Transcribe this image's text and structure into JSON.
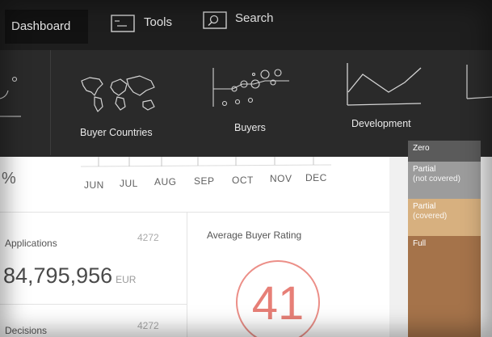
{
  "nav": {
    "dashboard": "Dashboard",
    "tools": "Tools",
    "search": "Search"
  },
  "tools": {
    "buyer_countries": "Buyer Countries",
    "buyers": "Buyers",
    "development": "Development"
  },
  "timeline": {
    "left_fragment": "%",
    "months": [
      "JUN",
      "JUL",
      "AUG",
      "SEP",
      "OCT",
      "NOV",
      "DEC"
    ]
  },
  "applications": {
    "title": "Applications",
    "count": "4272",
    "amount": "84,795,956",
    "unit": "EUR"
  },
  "decisions": {
    "title": "Decisions",
    "count": "4272"
  },
  "rating": {
    "title": "Average Buyer Rating",
    "value": "41"
  },
  "legend": [
    {
      "label": "Zero",
      "color": "#5b5b5b"
    },
    {
      "label": "Partial\n(not covered)",
      "color": "#9c9c9c"
    },
    {
      "label": "Partial\n(covered)",
      "color": "#d7b07f"
    },
    {
      "label": "Full",
      "color": "#a5734a"
    }
  ],
  "colors": {
    "nav_bg": "#1e1e1e",
    "tool_bg": "#2a2a2a",
    "rating_accent": "#e77f77"
  }
}
